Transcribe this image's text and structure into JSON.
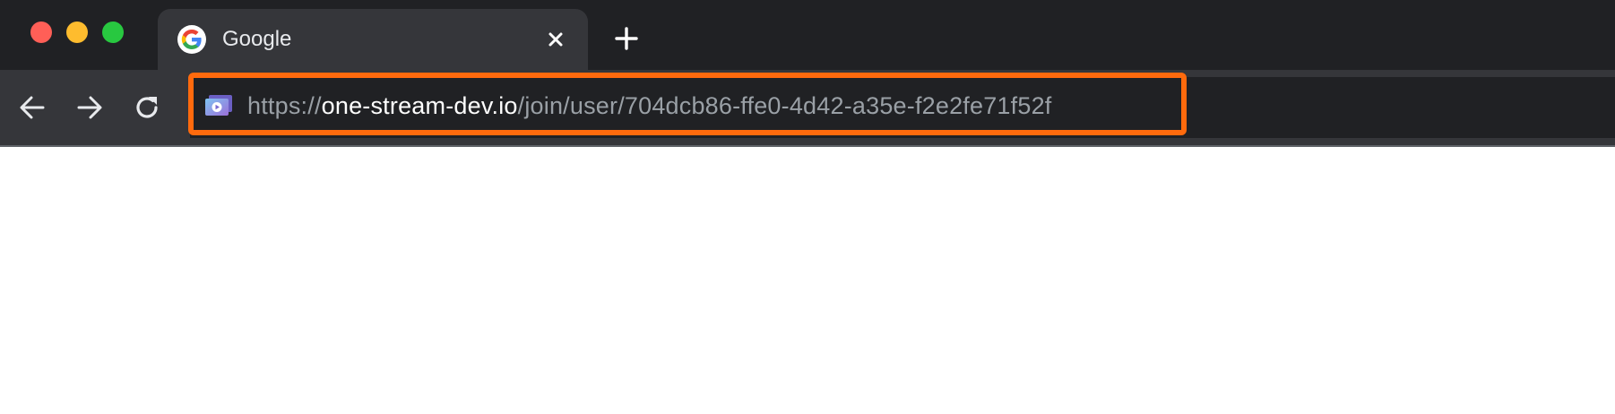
{
  "window": {
    "traffic_lights": {
      "close_color": "#ff5f57",
      "minimize_color": "#febc2e",
      "maximize_color": "#28c840"
    }
  },
  "tabs": [
    {
      "title": "Google",
      "favicon": "google-g-icon",
      "active": true,
      "close_icon": "close-icon"
    }
  ],
  "new_tab_icon": "plus-icon",
  "toolbar": {
    "back_icon": "arrow-left-icon",
    "forward_icon": "arrow-right-icon",
    "reload_icon": "reload-icon"
  },
  "address_bar": {
    "site_icon": "video-stream-icon",
    "url_scheme": "https://",
    "url_host": "one-stream-dev.io",
    "url_path": "/join/user/704dcb86-ffe0-4d42-a35e-f2e2fe71f52f",
    "highlight_color": "#ff6a0d"
  },
  "theme": {
    "tabstrip_bg": "#202124",
    "toolbar_bg": "#35363a",
    "content_bg": "#ffffff"
  }
}
